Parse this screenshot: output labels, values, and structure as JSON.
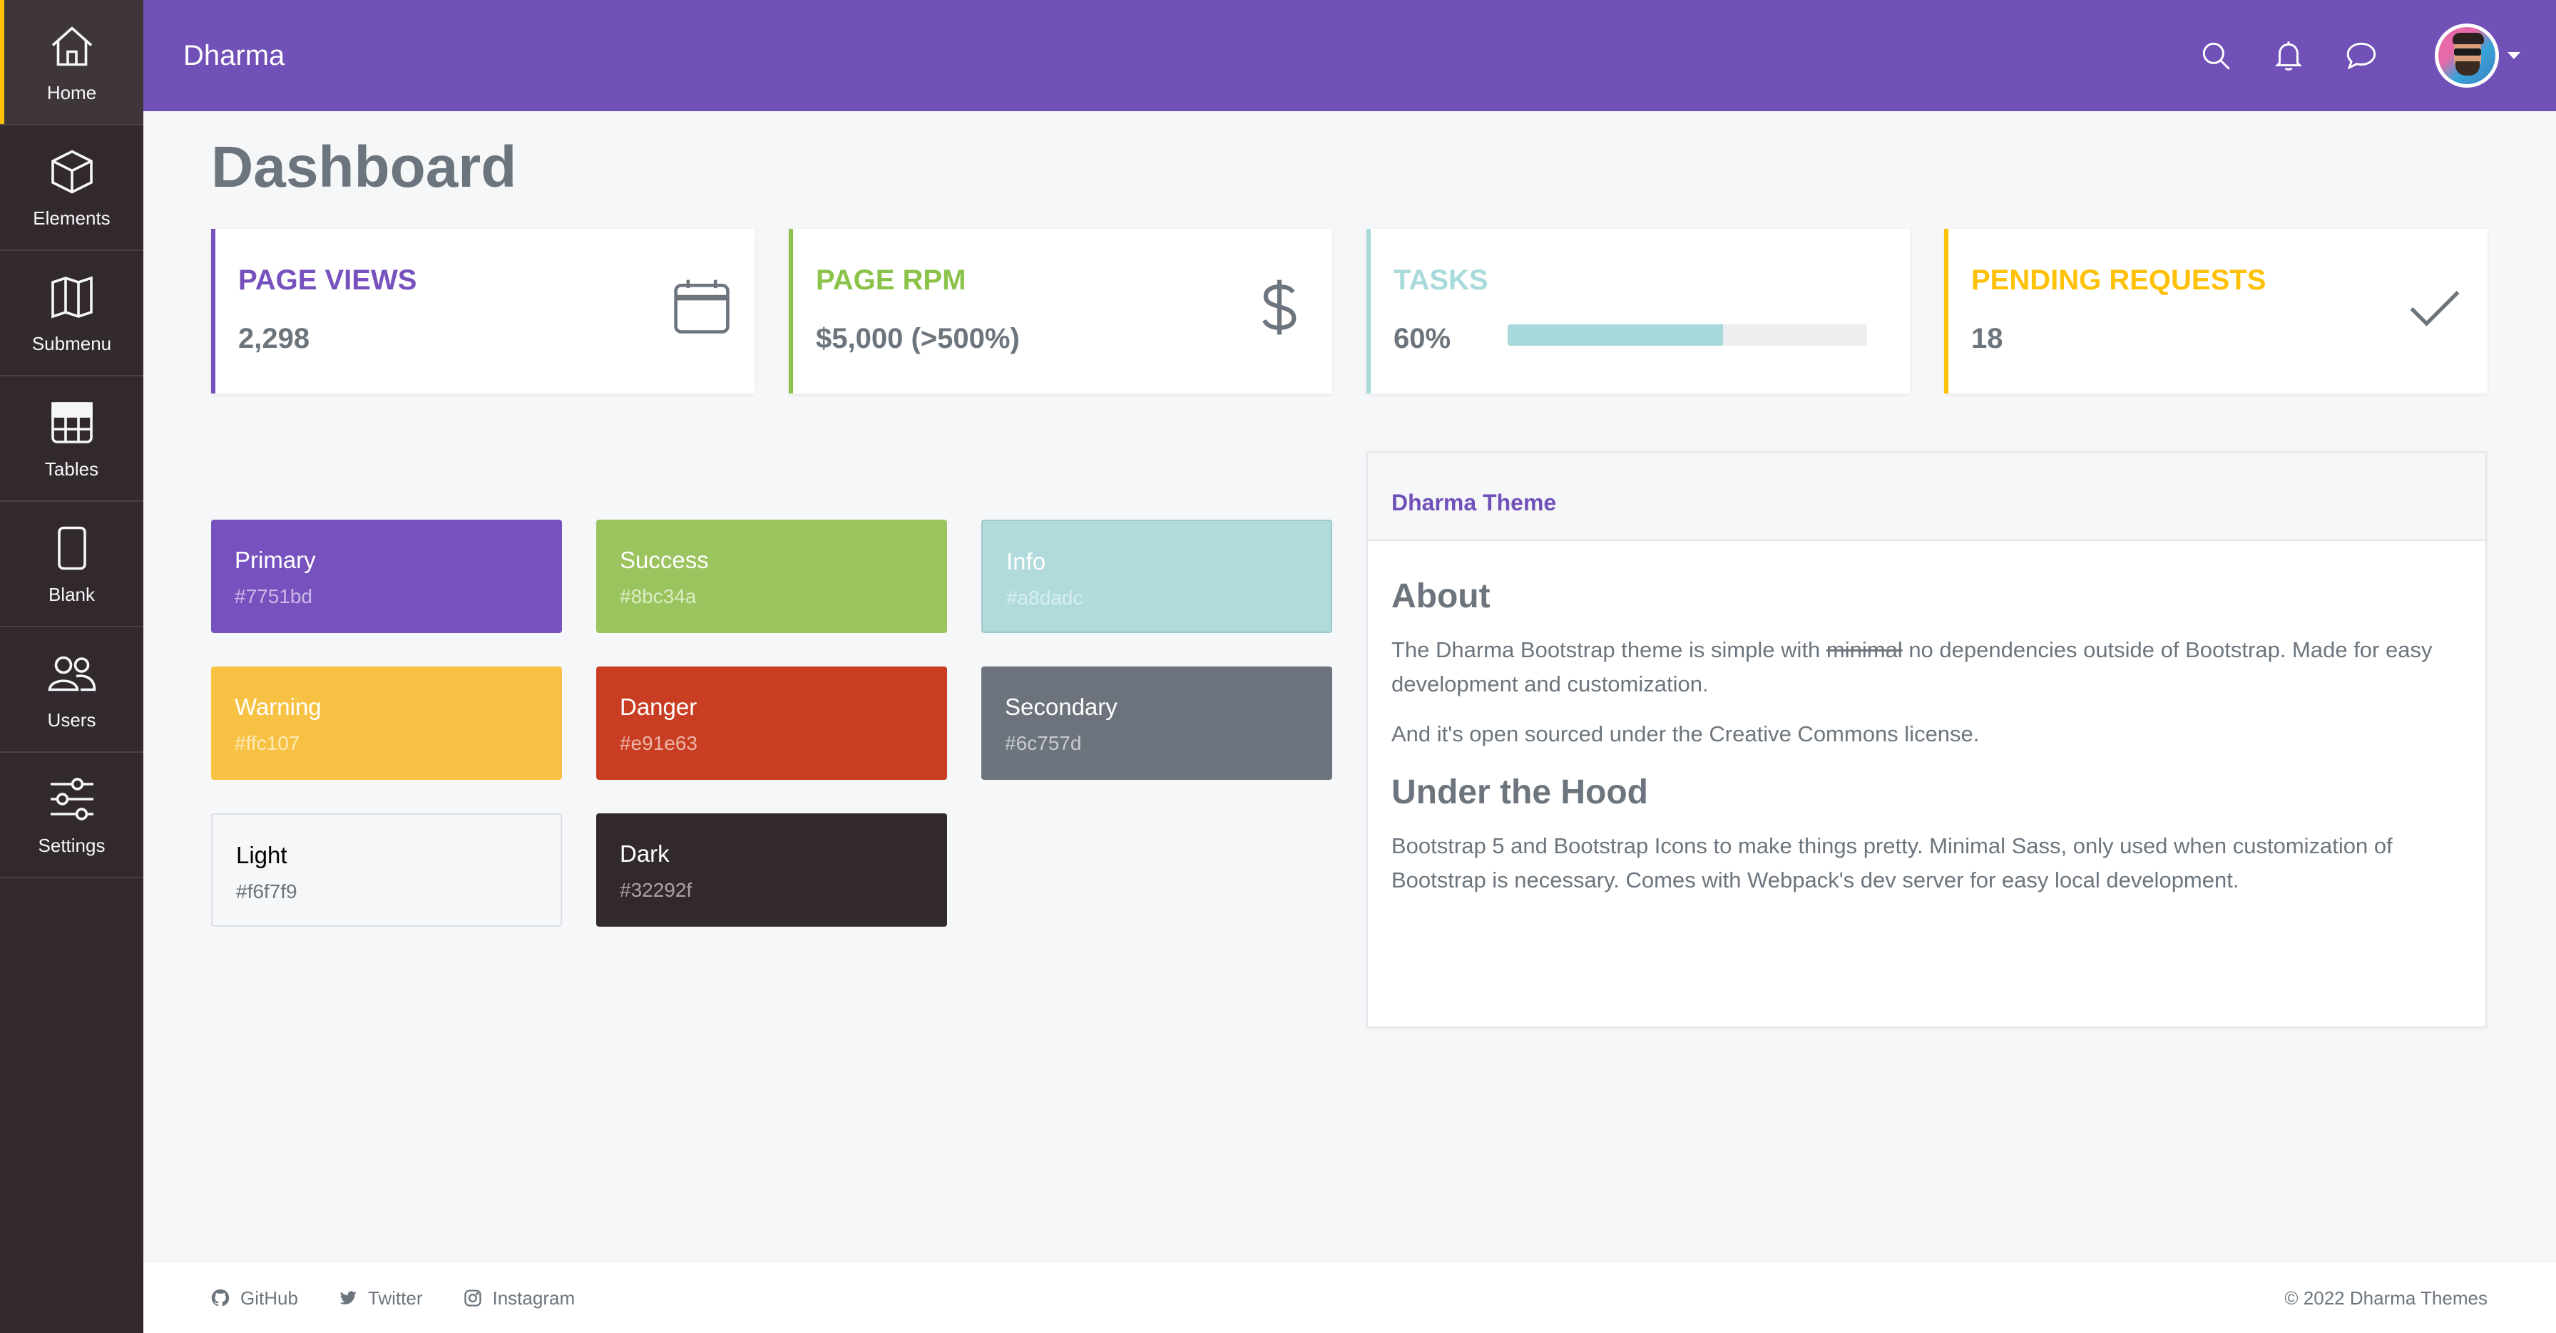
{
  "sidebar": {
    "items": [
      {
        "label": "Home",
        "icon": "home-icon"
      },
      {
        "label": "Elements",
        "icon": "cube-icon"
      },
      {
        "label": "Submenu",
        "icon": "map-icon"
      },
      {
        "label": "Tables",
        "icon": "table-icon"
      },
      {
        "label": "Blank",
        "icon": "phone-icon"
      },
      {
        "label": "Users",
        "icon": "users-icon"
      },
      {
        "label": "Settings",
        "icon": "sliders-icon"
      }
    ]
  },
  "header": {
    "brand": "Dharma",
    "icons": [
      "search-icon",
      "bell-icon",
      "chat-icon"
    ]
  },
  "page": {
    "title": "Dashboard"
  },
  "stats": [
    {
      "title": "PAGE VIEWS",
      "value": "2,298",
      "color": "#7751bd",
      "icon": "calendar-icon"
    },
    {
      "title": "PAGE RPM",
      "value": "$5,000 (>500%)",
      "color": "#8bc34a",
      "icon": "dollar-icon"
    },
    {
      "title": "TASKS",
      "value": "60%",
      "color": "#a8dadc",
      "progress": 0.6
    },
    {
      "title": "PENDING REQUESTS",
      "value": "18",
      "color": "#ffc107",
      "icon": "check-icon"
    }
  ],
  "colors": [
    {
      "name": "Primary",
      "hex": "#7751bd"
    },
    {
      "name": "Success",
      "hex": "#8bc34a"
    },
    {
      "name": "Info",
      "hex": "#a8dadc"
    },
    {
      "name": "Warning",
      "hex": "#ffc107"
    },
    {
      "name": "Danger",
      "hex": "#e91e63"
    },
    {
      "name": "Secondary",
      "hex": "#6c757d"
    },
    {
      "name": "Light",
      "hex": "#f6f7f9"
    },
    {
      "name": "Dark",
      "hex": "#32292f"
    }
  ],
  "theme": {
    "header": "Dharma Theme",
    "about_heading": "About",
    "about_p1_a": "The Dharma Bootstrap theme is simple with ",
    "about_p1_strike": "minimal",
    "about_p1_b": " no dependencies outside of Bootstrap. Made for easy development and customization.",
    "about_p2": "And it's open sourced under the Creative Commons license.",
    "hood_heading": "Under the Hood",
    "hood_p": "Bootstrap 5 and Bootstrap Icons to make things pretty. Minimal Sass, only used when customization of Bootstrap is necessary. Comes with Webpack's dev server for easy local development."
  },
  "footer": {
    "links": [
      {
        "label": "GitHub",
        "icon": "github-icon"
      },
      {
        "label": "Twitter",
        "icon": "twitter-icon"
      },
      {
        "label": "Instagram",
        "icon": "instagram-icon"
      }
    ],
    "copyright": "© 2022 Dharma Themes"
  }
}
